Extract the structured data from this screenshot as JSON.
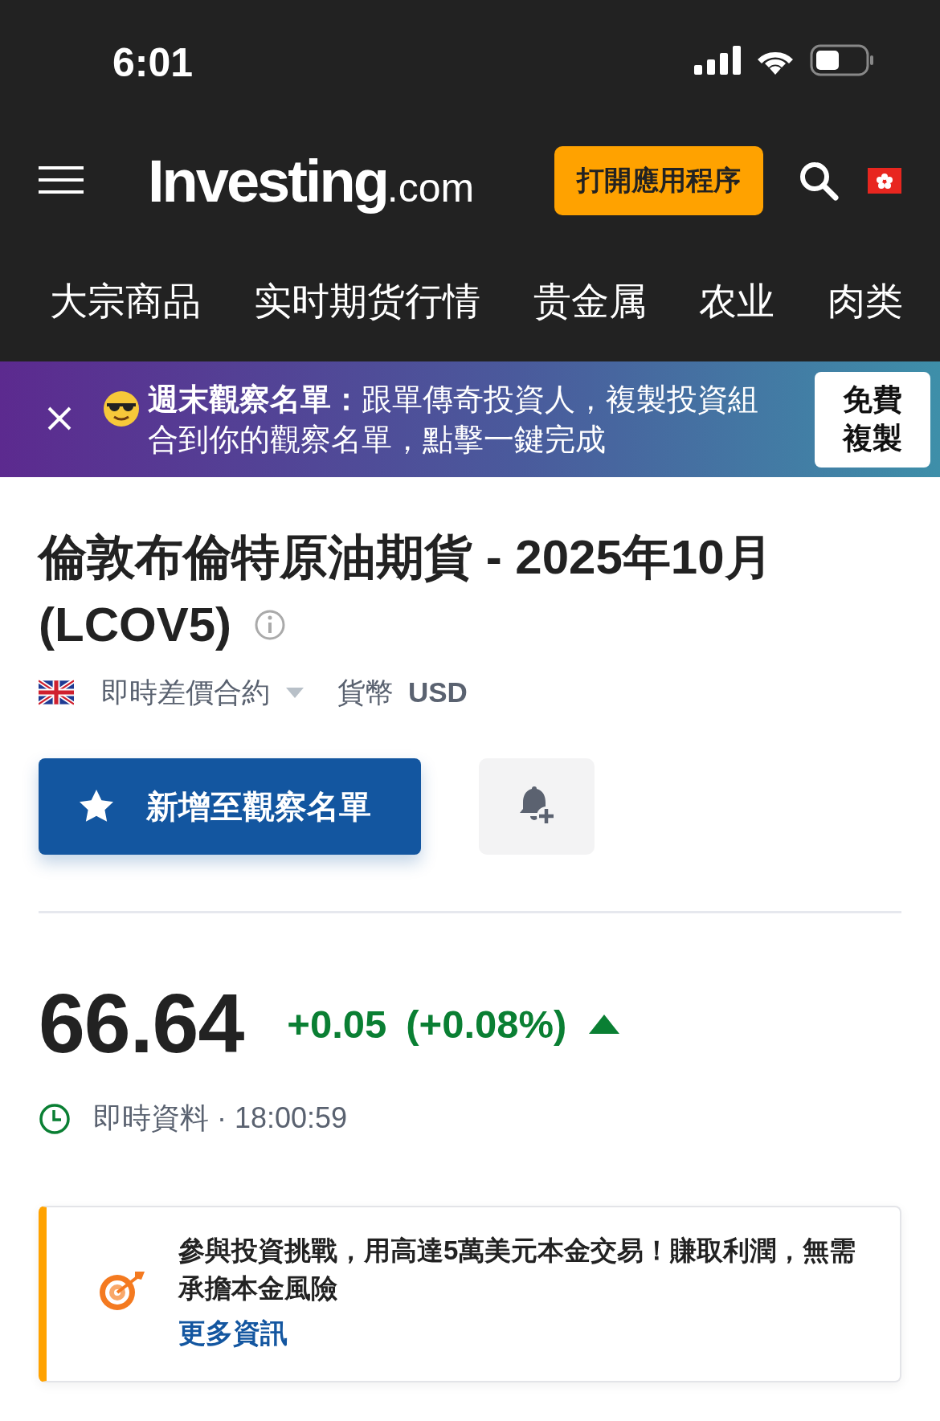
{
  "status_bar": {
    "time": "6:01"
  },
  "header": {
    "logo": {
      "name": "Investing",
      "suffix": ".com"
    },
    "open_app_button": "打開應用程序"
  },
  "nav_tabs": [
    {
      "label": "大宗商品"
    },
    {
      "label": "实时期货行情"
    },
    {
      "label": "贵金属"
    },
    {
      "label": "农业"
    },
    {
      "label": "肉类"
    }
  ],
  "promo_banner": {
    "text": "**週末觀察名單：**跟單傳奇投資人，複製投資組合到你的觀察名單，點擊一鍵完成",
    "button": "免費複製"
  },
  "instrument": {
    "title": "倫敦布倫特原油期貨 - 2025年10月",
    "symbol": "(LCOV5)",
    "contract_type": "即時差價合約",
    "currency_label": "貨幣",
    "currency": "USD",
    "watchlist_button": "新增至觀察名單"
  },
  "quote": {
    "price": "66.64",
    "change": "+0.05",
    "change_percent": "(+0.08%)",
    "rising": true,
    "data_label": "即時資料",
    "time": "· 18:00:59"
  },
  "challenge_card": {
    "text": "參與投資挑戰，用高達5萬美元本金交易！賺取利潤，無需承擔本金風險",
    "link": "更多資訊"
  }
}
